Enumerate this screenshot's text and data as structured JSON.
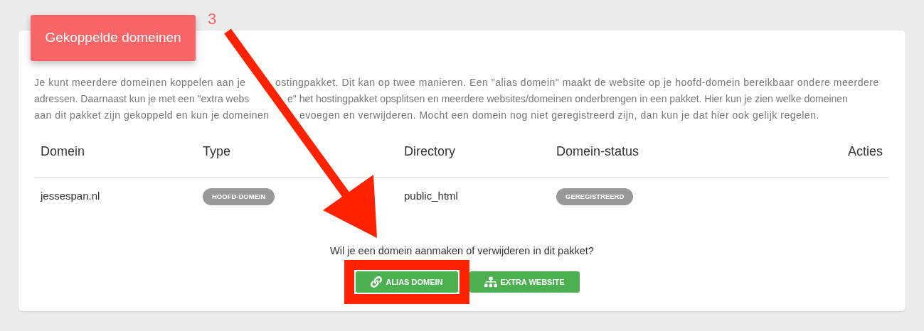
{
  "card": {
    "title": "Gekoppelde domeinen",
    "description_lines": [
      {
        "before": "Je kunt meerdere domeinen koppelen aan je",
        "after": "ostingpakket. Dit kan op twee manieren. Een \"alias domein\" maakt de website op je hoofd-domein bereikbaar ondere meerdere"
      },
      {
        "before": "adressen. Daarnaast kun je met een \"extra webs",
        "after": "e\" het hostingpakket opsplitsen en meerdere websites/domeinen onderbrengen in een pakket. Hier kun je zien welke domeinen"
      },
      {
        "before": "aan dit pakket zijn gekoppeld en kun je domeinen",
        "after": "evoegen en verwijderen. Mocht een domein nog niet geregistreerd zijn, dan kun je dat hier ook gelijk regelen."
      }
    ]
  },
  "table": {
    "columns": [
      "Domein",
      "Type",
      "Directory",
      "Domein-status",
      "Acties"
    ],
    "rows": [
      {
        "domain": "jessespan.nl",
        "type": "HOOFD-DOMEIN",
        "directory": "public_html",
        "status": "GEREGISTREERD"
      }
    ]
  },
  "prompt": "Wil je een domein aanmaken of verwijderen in dit pakket?",
  "buttons": [
    {
      "kind": "link",
      "label": "ALIAS DOMEIN",
      "highlighted": true
    },
    {
      "kind": "sitemap",
      "label": "EXTRA WEBSITE",
      "highlighted": false
    }
  ],
  "annotation": {
    "step": "3"
  }
}
